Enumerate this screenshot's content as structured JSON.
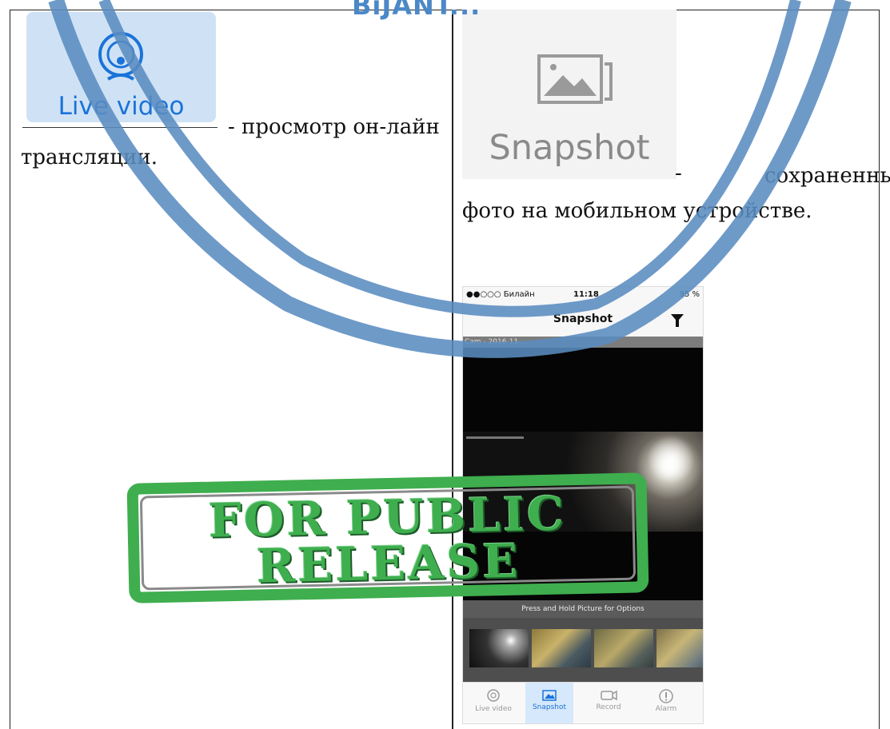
{
  "header": {
    "banner_text": "BiJANT..."
  },
  "left": {
    "icon_label": "Live video",
    "desc_line1": "- просмотр он-лайн",
    "desc_line2": "трансляции."
  },
  "right": {
    "icon_label": "Snapshot",
    "dash": "-",
    "desc_line1": "сохраненные",
    "desc_line2": "фото на мобильном устройстве."
  },
  "phone": {
    "carrier": "●●○○○ Билайн",
    "time": "11:18",
    "battery": "95 %",
    "title": "Snapshot",
    "cam_caption": "Cam - 2016-11-...",
    "hint": "Press and Hold Picture for Options",
    "tabs": [
      {
        "label": "Live video",
        "icon": "camera-icon"
      },
      {
        "label": "Snapshot",
        "icon": "picture-icon"
      },
      {
        "label": "Record",
        "icon": "video-icon"
      },
      {
        "label": "Alarm",
        "icon": "alert-icon"
      }
    ],
    "active_tab": "Snapshot"
  },
  "watermark": {
    "line1": "FOR PUBLIC",
    "line2": "RELEASE"
  },
  "colors": {
    "stamp_green": "#3fae4e",
    "ribbon_blue": "#4b88c7",
    "live_blue": "#1a73d9"
  }
}
